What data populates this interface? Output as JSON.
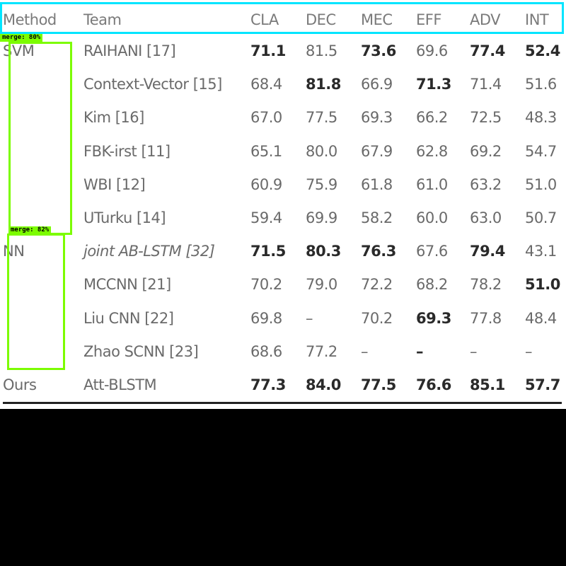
{
  "table": {
    "columns": [
      "Method",
      "Team",
      "CLA",
      "DEC",
      "MEC",
      "EFF",
      "ADV",
      "INT"
    ],
    "rows": [
      {
        "method": "SVM",
        "team": "RAIHANI [17]",
        "team_italic": false,
        "values": [
          "71.1",
          "81.5",
          "73.6",
          "69.6",
          "77.4",
          "52.4"
        ],
        "bold": [
          true,
          false,
          true,
          false,
          true,
          true
        ]
      },
      {
        "method": "",
        "team": "Context-Vector [15]",
        "team_italic": false,
        "values": [
          "68.4",
          "81.8",
          "66.9",
          "71.3",
          "71.4",
          "51.6"
        ],
        "bold": [
          false,
          true,
          false,
          true,
          false,
          false
        ]
      },
      {
        "method": "",
        "team": "Kim [16]",
        "team_italic": false,
        "values": [
          "67.0",
          "77.5",
          "69.3",
          "66.2",
          "72.5",
          "48.3"
        ],
        "bold": [
          false,
          false,
          false,
          false,
          false,
          false
        ]
      },
      {
        "method": "",
        "team": "FBK-irst [11]",
        "team_italic": false,
        "values": [
          "65.1",
          "80.0",
          "67.9",
          "62.8",
          "69.2",
          "54.7"
        ],
        "bold": [
          false,
          false,
          false,
          false,
          false,
          false
        ]
      },
      {
        "method": "",
        "team": "WBI [12]",
        "team_italic": false,
        "values": [
          "60.9",
          "75.9",
          "61.8",
          "61.0",
          "63.2",
          "51.0"
        ],
        "bold": [
          false,
          false,
          false,
          false,
          false,
          false
        ]
      },
      {
        "method": "",
        "team": "UTurku [14]",
        "team_italic": false,
        "values": [
          "59.4",
          "69.9",
          "58.2",
          "60.0",
          "63.0",
          "50.7"
        ],
        "bold": [
          false,
          false,
          false,
          false,
          false,
          false
        ]
      },
      {
        "method": "NN",
        "team": "joint AB-LSTM [32]",
        "team_italic": true,
        "values": [
          "71.5",
          "80.3",
          "76.3",
          "67.6",
          "79.4",
          "43.1"
        ],
        "bold": [
          true,
          true,
          true,
          false,
          true,
          false
        ]
      },
      {
        "method": "",
        "team": "MCCNN [21]",
        "team_italic": false,
        "values": [
          "70.2",
          "79.0",
          "72.2",
          "68.2",
          "78.2",
          "51.0"
        ],
        "bold": [
          false,
          false,
          false,
          false,
          false,
          true
        ]
      },
      {
        "method": "",
        "team": "Liu CNN [22]",
        "team_italic": false,
        "values": [
          "69.8",
          "–",
          "70.2",
          "69.3",
          "77.8",
          "48.4"
        ],
        "bold": [
          false,
          false,
          false,
          true,
          false,
          false
        ]
      },
      {
        "method": "",
        "team": "Zhao SCNN [23]",
        "team_italic": false,
        "values": [
          "68.6",
          "77.2",
          "–",
          "–",
          "–",
          "–"
        ],
        "bold": [
          false,
          false,
          false,
          true,
          false,
          false
        ]
      },
      {
        "method": "Ours",
        "team": "Att-BLSTM",
        "team_italic": false,
        "values": [
          "77.3",
          "84.0",
          "77.5",
          "76.6",
          "85.1",
          "57.7"
        ],
        "bold": [
          true,
          true,
          true,
          true,
          true,
          true
        ]
      }
    ]
  },
  "overlays": [
    {
      "label": "merge: 80%",
      "color": "#7cfc00"
    },
    {
      "label": "merge: 82%",
      "color": "#7cfc00"
    }
  ]
}
